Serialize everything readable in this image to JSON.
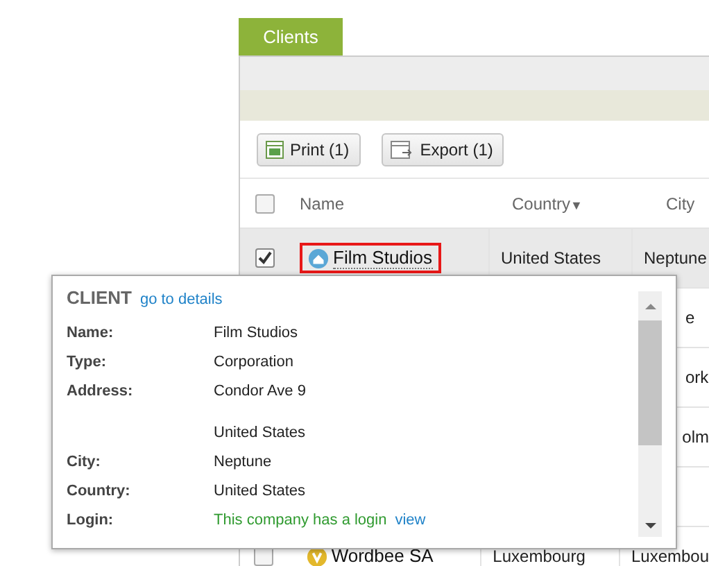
{
  "tabs": [
    {
      "label": "Clients",
      "selected": true
    }
  ],
  "toolbar": [
    {
      "kind": "print",
      "label": "Print (1)"
    },
    {
      "kind": "export",
      "label": "Export (1)"
    }
  ],
  "table": {
    "header_checked": false,
    "columns": [
      {
        "label": "Name"
      },
      {
        "label": "Country",
        "sort_indicator": "▼"
      },
      {
        "label": "City"
      }
    ],
    "rows": [
      {
        "checked": true,
        "selected": true,
        "kind": "house",
        "name": "Film Studios",
        "country": "United States",
        "city": "Neptune"
      },
      {
        "city": "e"
      },
      {
        "city": "ork"
      },
      {
        "city": "olm"
      },
      {},
      {
        "checked": false,
        "selected": false,
        "kind": "badge",
        "name": "Wordbee SA",
        "country": "Luxembourg",
        "city": "Luxembou"
      }
    ]
  },
  "popup": {
    "title": "CLIENT",
    "link": "go to details",
    "fields": [
      {
        "kind": "text",
        "label": "Name:",
        "value": "Film Studios"
      },
      {
        "kind": "text",
        "label": "Type:",
        "value": "Corporation"
      },
      {
        "kind": "text",
        "label": "Address:",
        "value": "Condor Ave 9"
      },
      {
        "kind": "text",
        "value": "United States"
      },
      {
        "kind": "text",
        "label": "City:",
        "value": "Neptune"
      },
      {
        "kind": "text",
        "label": "Country:",
        "value": "United States"
      },
      {
        "kind": "login",
        "label": "Login:",
        "value": "This company has a login",
        "link": "view"
      }
    ]
  }
}
